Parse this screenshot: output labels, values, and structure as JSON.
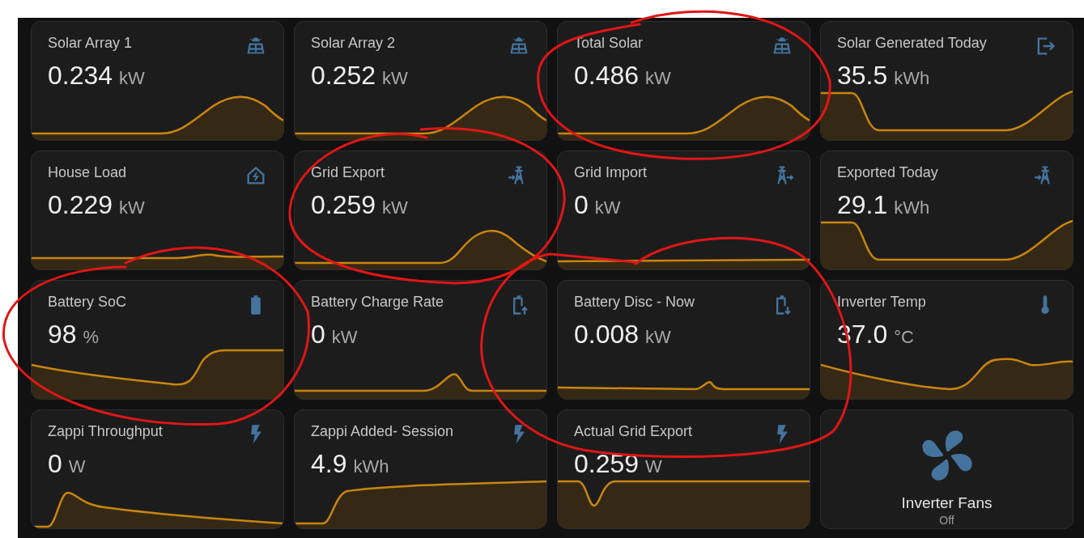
{
  "cards": [
    {
      "kind": "sensor",
      "name": "Solar Array 1",
      "value": "0.234",
      "unit": "kW"
    },
    {
      "kind": "sensor",
      "name": "Solar Array 2",
      "value": "0.252",
      "unit": "kW"
    },
    {
      "kind": "sensor",
      "name": "Total Solar",
      "value": "0.486",
      "unit": "kW"
    },
    {
      "kind": "sensor",
      "name": "Solar Generated Today",
      "value": "35.5",
      "unit": "kWh"
    },
    {
      "kind": "sensor",
      "name": "House Load",
      "value": "0.229",
      "unit": "kW"
    },
    {
      "kind": "sensor",
      "name": "Grid Export",
      "value": "0.259",
      "unit": "kW"
    },
    {
      "kind": "sensor",
      "name": "Grid Import",
      "value": "0",
      "unit": "kW"
    },
    {
      "kind": "sensor",
      "name": "Exported Today",
      "value": "29.1",
      "unit": "kWh"
    },
    {
      "kind": "sensor",
      "name": "Battery SoC",
      "value": "98",
      "unit": "%"
    },
    {
      "kind": "sensor",
      "name": "Battery Charge Rate",
      "value": "0",
      "unit": "kW"
    },
    {
      "kind": "sensor",
      "name": "Battery Disc - Now",
      "value": "0.008",
      "unit": "kW"
    },
    {
      "kind": "sensor",
      "name": "Inverter Temp",
      "value": "37.0",
      "unit": "°C"
    },
    {
      "kind": "sensor",
      "name": "Zappi Throughput",
      "value": "0",
      "unit": "W"
    },
    {
      "kind": "sensor",
      "name": "Zappi Added- Session",
      "value": "4.9",
      "unit": "kWh"
    },
    {
      "kind": "sensor",
      "name": "Actual Grid Export",
      "value": "0.259",
      "unit": "W"
    },
    {
      "kind": "toggle",
      "name": "Inverter Fans",
      "state": "Off"
    }
  ]
}
